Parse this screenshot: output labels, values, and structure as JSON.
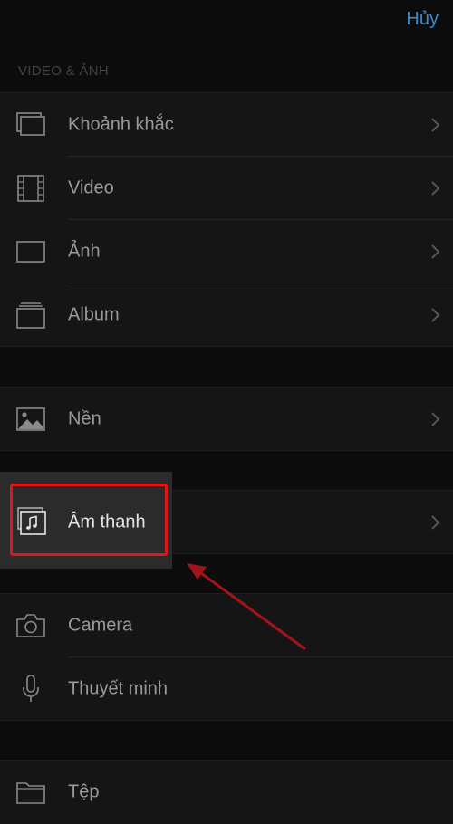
{
  "header": {
    "cancel_label": "Hủy"
  },
  "section": {
    "title": "VIDEO & ẢNH"
  },
  "items": [
    {
      "label": "Khoảnh khắc",
      "icon": "moments-icon",
      "chevron": true
    },
    {
      "label": "Video",
      "icon": "film-icon",
      "chevron": true
    },
    {
      "label": "Ảnh",
      "icon": "photo-frame-icon",
      "chevron": true
    },
    {
      "label": "Album",
      "icon": "album-icon",
      "chevron": true
    },
    {
      "label": "Nền",
      "icon": "wallpaper-icon",
      "chevron": true
    },
    {
      "label": "Âm thanh",
      "icon": "music-icon",
      "chevron": true
    },
    {
      "label": "Camera",
      "icon": "camera-icon",
      "chevron": false
    },
    {
      "label": "Thuyết minh",
      "icon": "microphone-icon",
      "chevron": false
    },
    {
      "label": "Tệp",
      "icon": "folder-icon",
      "chevron": false
    }
  ],
  "colors": {
    "accent": "#3a89c9",
    "highlight_border": "#e0161b",
    "arrow": "#a3141a"
  }
}
